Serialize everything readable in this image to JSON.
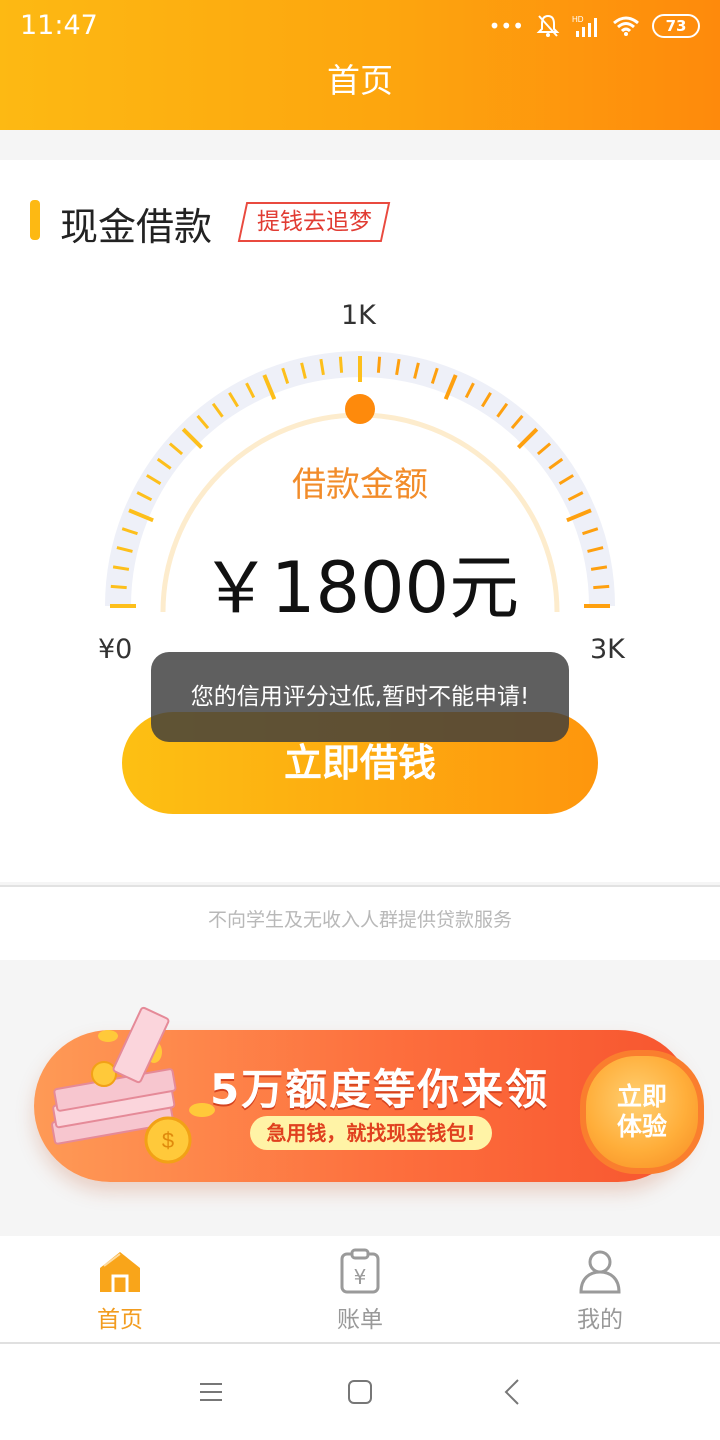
{
  "status_bar": {
    "time": "11:47",
    "battery": "73"
  },
  "header": {
    "title": "首页"
  },
  "loan_section": {
    "title": "现金借款",
    "slogan": "提钱去追梦",
    "gauge": {
      "min_label": "¥0",
      "mid_label": "1K",
      "max_label": "3K"
    },
    "amount_label": "借款金额",
    "amount": "￥1800元",
    "button_label": "立即借钱",
    "toast_message": "您的信用评分过低,暂时不能申请!"
  },
  "disclaimer": "不向学生及无收入人群提供贷款服务",
  "banner": {
    "headline": "5万额度等你来领",
    "subline": "急用钱，就找现金钱包!",
    "cta_line1": "立即",
    "cta_line2": "体验"
  },
  "tabs": [
    {
      "label": "首页",
      "icon": "home-icon",
      "active": true
    },
    {
      "label": "账单",
      "icon": "bill-icon",
      "active": false
    },
    {
      "label": "我的",
      "icon": "profile-icon",
      "active": false
    }
  ],
  "colors": {
    "accent": "#fdb913",
    "accent_dark": "#fe8a0c",
    "active_tab": "#f29c1f",
    "inactive_tab": "#999999"
  }
}
